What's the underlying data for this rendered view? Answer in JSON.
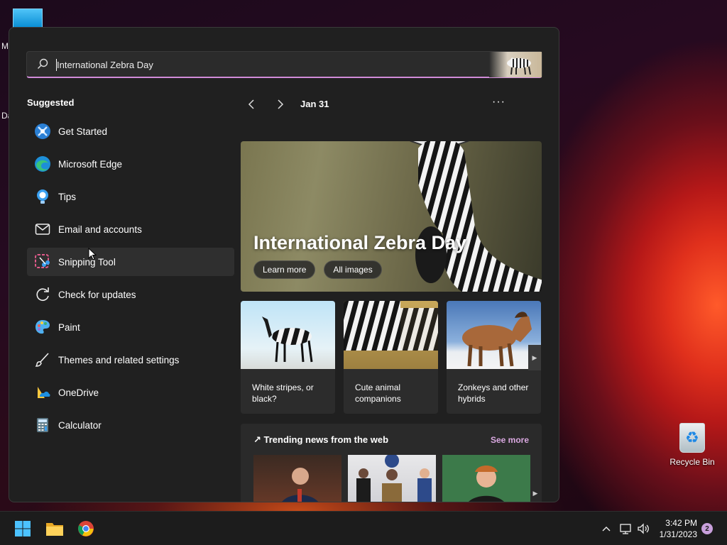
{
  "desktop": {
    "fragment_m": "M",
    "fragment_da": "Da",
    "recycle_bin_label": "Recycle Bin"
  },
  "search": {
    "value": "International Zebra Day",
    "placeholder": ""
  },
  "suggested": {
    "title": "Suggested",
    "items": [
      {
        "label": "Get Started",
        "icon": "get-started-icon"
      },
      {
        "label": "Microsoft Edge",
        "icon": "edge-icon"
      },
      {
        "label": "Tips",
        "icon": "tips-icon"
      },
      {
        "label": "Email and accounts",
        "icon": "mail-icon"
      },
      {
        "label": "Snipping Tool",
        "icon": "snipping-tool-icon"
      },
      {
        "label": "Check for updates",
        "icon": "refresh-icon"
      },
      {
        "label": "Paint",
        "icon": "paint-icon"
      },
      {
        "label": "Themes and related settings",
        "icon": "brush-icon"
      },
      {
        "label": "OneDrive",
        "icon": "onedrive-icon"
      },
      {
        "label": "Calculator",
        "icon": "calculator-icon"
      }
    ]
  },
  "highlights": {
    "date": "Jan 31",
    "more_label": "···",
    "hero": {
      "title": "International Zebra Day",
      "learn_more": "Learn more",
      "all_images": "All images"
    },
    "cards": [
      {
        "caption": "White stripes, or black?"
      },
      {
        "caption": "Cute animal companions"
      },
      {
        "caption": "Zonkeys and other hybrids"
      }
    ],
    "news": {
      "title": "Trending news from the web",
      "see_more": "See more"
    }
  },
  "taskbar": {
    "time": "3:42 PM",
    "date": "1/31/2023",
    "notification_count": "2"
  },
  "colors": {
    "panel_bg": "#202020",
    "accent": "#d08bd8",
    "taskbar_bg": "#1c1c1c"
  }
}
